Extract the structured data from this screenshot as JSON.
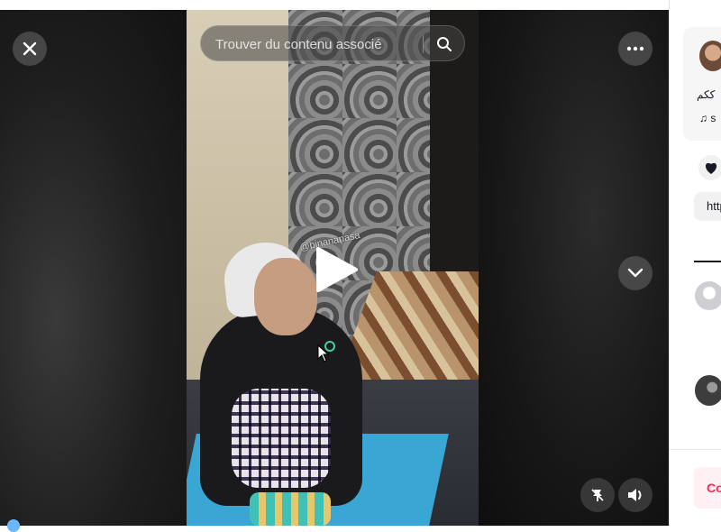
{
  "search": {
    "placeholder": "Trouver du contenu associé"
  },
  "video": {
    "watermark": "@binananasa"
  },
  "side_panel": {
    "caption": "ككم",
    "music": "s",
    "link": "http",
    "post_button": "Co"
  },
  "icons": {
    "close": "close-icon",
    "search": "search-icon",
    "more": "more-dots-icon",
    "down": "chevron-down-icon",
    "sound": "volume-icon",
    "pin": "pin-icon",
    "play": "play-icon",
    "heart": "heart-icon",
    "music": "music-note-icon"
  },
  "colors": {
    "accent": "#fe2c55",
    "overlay_button": "#545454"
  }
}
